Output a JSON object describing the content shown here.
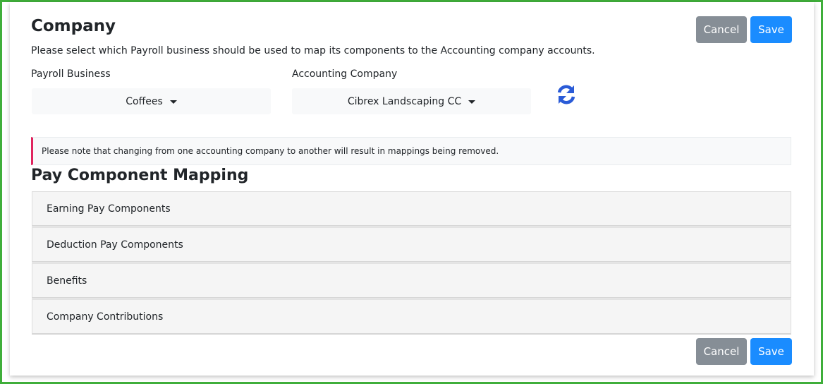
{
  "page": {
    "title": "Company",
    "description": "Please select which Payroll business should be used to map its components to the Accounting company accounts."
  },
  "payroll_business": {
    "label": "Payroll Business",
    "selected": "Coffees"
  },
  "accounting_company": {
    "label": "Accounting Company",
    "selected": "Cibrex Landscaping CC"
  },
  "buttons": {
    "cancel": "Cancel",
    "save": "Save"
  },
  "notice": {
    "text": "Please note that changing from one accounting company to another will result in mappings being removed."
  },
  "mapping": {
    "title": "Pay Component Mapping",
    "sections": [
      {
        "label": "Earning Pay Components"
      },
      {
        "label": "Deduction Pay Components"
      },
      {
        "label": "Benefits"
      },
      {
        "label": "Company Contributions"
      }
    ]
  },
  "icons": {
    "refresh": "refresh-icon",
    "caret": "caret-down-icon"
  },
  "colors": {
    "frame": "#3fae3a",
    "primary": "#1a8cff",
    "secondary": "#868e96",
    "notice_accent": "#e0245e",
    "refresh_icon": "#2a5bd7"
  }
}
